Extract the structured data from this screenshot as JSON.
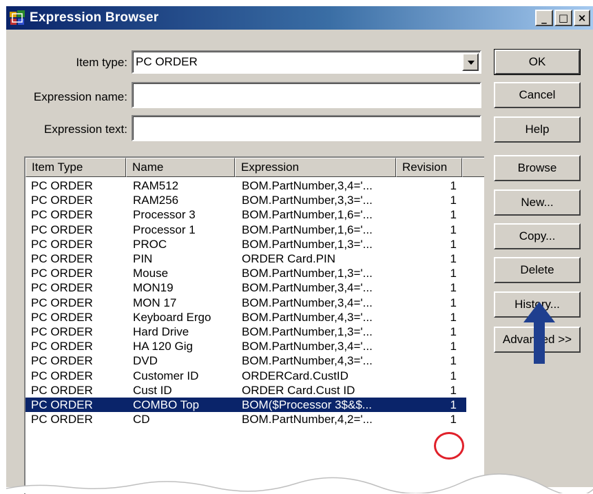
{
  "window": {
    "title": "Expression Browser"
  },
  "titlebar_buttons": {
    "minimize": "_",
    "maximize": "□",
    "close": "×"
  },
  "form": {
    "item_type_label": "Item type:",
    "item_type_value": "PC ORDER",
    "expression_name_label": "Expression name:",
    "expression_name_value": "",
    "expression_text_label": "Expression text:",
    "expression_text_value": ""
  },
  "buttons": {
    "ok": "OK",
    "cancel": "Cancel",
    "help": "Help",
    "browse": "Browse",
    "new": "New...",
    "copy": "Copy...",
    "delete": "Delete",
    "history": "History...",
    "advanced": "Advanced >>"
  },
  "table": {
    "columns": [
      "Item Type",
      "Name",
      "Expression",
      "Revision"
    ],
    "rows": [
      [
        "PC ORDER",
        "RAM512",
        "BOM.PartNumber,3,4='...",
        "1"
      ],
      [
        "PC ORDER",
        "RAM256",
        "BOM.PartNumber,3,3='...",
        "1"
      ],
      [
        "PC ORDER",
        "Processor 3",
        "BOM.PartNumber,1,6='...",
        "1"
      ],
      [
        "PC ORDER",
        "Processor 1",
        "BOM.PartNumber,1,6='...",
        "1"
      ],
      [
        "PC ORDER",
        "PROC",
        "BOM.PartNumber,1,3='...",
        "1"
      ],
      [
        "PC ORDER",
        "PIN",
        "ORDER Card.PIN",
        "1"
      ],
      [
        "PC ORDER",
        "Mouse",
        "BOM.PartNumber,1,3='...",
        "1"
      ],
      [
        "PC ORDER",
        "MON19",
        "BOM.PartNumber,3,4='...",
        "1"
      ],
      [
        "PC ORDER",
        "MON 17",
        "BOM.PartNumber,3,4='...",
        "1"
      ],
      [
        "PC ORDER",
        "Keyboard Ergo",
        "BOM.PartNumber,4,3='...",
        "1"
      ],
      [
        "PC ORDER",
        "Hard Drive",
        "BOM.PartNumber,1,3='...",
        "1"
      ],
      [
        "PC ORDER",
        "HA 120 Gig",
        "BOM.PartNumber,3,4='...",
        "1"
      ],
      [
        "PC ORDER",
        "DVD",
        "BOM.PartNumber,4,3='...",
        "1"
      ],
      [
        "PC ORDER",
        "Customer ID",
        "ORDERCard.CustID",
        "1"
      ],
      [
        "PC ORDER",
        "Cust ID",
        "ORDER Card.Cust ID",
        "1"
      ],
      [
        "PC ORDER",
        "COMBO Top",
        "BOM($Processor 3$&$...",
        "1"
      ],
      [
        "PC ORDER",
        "CD",
        "BOM.PartNumber,4,2='...",
        "1"
      ]
    ],
    "selected_row_index": 15
  },
  "colors": {
    "title_gradient_start": "#0a246a",
    "dialog_face": "#d4d0c8",
    "selection": "#0a246a",
    "annotation_red": "#e0202a",
    "annotation_arrow": "#1f3f8f"
  },
  "icons": {
    "app": "expression-browser-app-icon",
    "annotation_arrow": "up-arrow-icon"
  }
}
